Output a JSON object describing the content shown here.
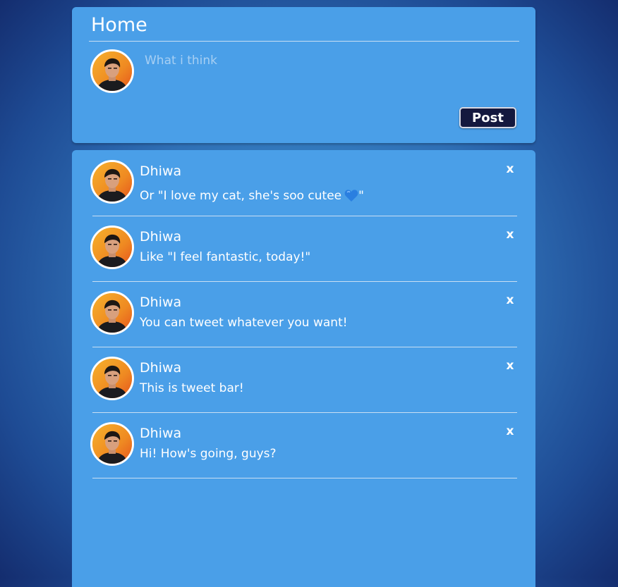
{
  "header": {
    "title": "Home"
  },
  "compose": {
    "placeholder": "What i think",
    "post_label": "Post",
    "avatar_icon": "user-avatar-photo"
  },
  "feed": {
    "tweets": [
      {
        "author": "Dhiwa",
        "text": "Or \"I love my cat, she's soo cutee",
        "text_suffix": "\"",
        "emoji": "blue-heart",
        "delete_label": "x"
      },
      {
        "author": "Dhiwa",
        "text": "Like \"I feel fantastic, today!\"",
        "delete_label": "x"
      },
      {
        "author": "Dhiwa",
        "text": "You can tweet whatever you want!",
        "delete_label": "x"
      },
      {
        "author": "Dhiwa",
        "text": "This is tweet bar!",
        "delete_label": "x"
      },
      {
        "author": "Dhiwa",
        "text": "Hi! How's going, guys?",
        "delete_label": "x"
      }
    ]
  },
  "colors": {
    "panel": "#4a9fe8",
    "post_button_bg": "#14183e",
    "text": "#ffffff",
    "placeholder": "#a7cff3",
    "heart": "#2a7fe0"
  }
}
